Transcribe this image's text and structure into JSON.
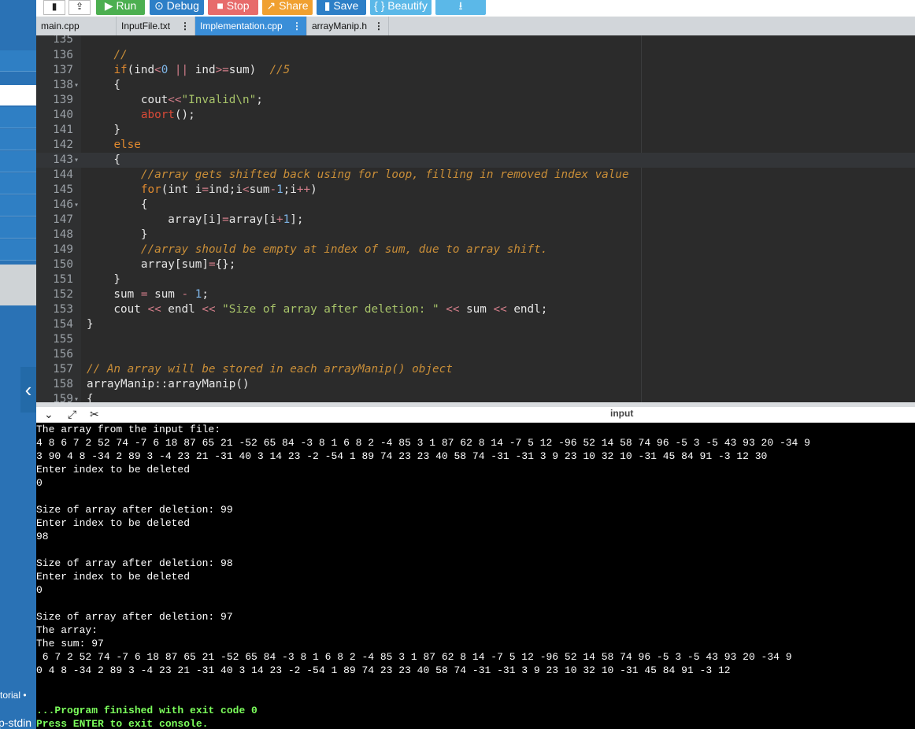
{
  "toolbar": {
    "run": "▶ Run",
    "debug": "⊙ Debug",
    "stop": "■ Stop",
    "share": "↗ Share",
    "save": "▮ Save",
    "beautify": "{ } Beautify",
    "download": "⭳"
  },
  "tabs": [
    {
      "label": "main.cpp"
    },
    {
      "label": "InputFile.txt"
    },
    {
      "label": "Implementation.cpp"
    },
    {
      "label": "arrayManip.h"
    }
  ],
  "tab_menu_glyph": "⋮",
  "sidebar": {
    "collapse_glyph": "‹",
    "tutorial_label": "torial •",
    "stdin_label": "p-stdin"
  },
  "editor": {
    "lines": [
      {
        "n": "135",
        "fold": false
      },
      {
        "n": "136",
        "fold": false
      },
      {
        "n": "137",
        "fold": false
      },
      {
        "n": "138",
        "fold": true
      },
      {
        "n": "139",
        "fold": false
      },
      {
        "n": "140",
        "fold": false
      },
      {
        "n": "141",
        "fold": false
      },
      {
        "n": "142",
        "fold": false
      },
      {
        "n": "143",
        "fold": true
      },
      {
        "n": "144",
        "fold": false
      },
      {
        "n": "145",
        "fold": false
      },
      {
        "n": "146",
        "fold": true
      },
      {
        "n": "147",
        "fold": false
      },
      {
        "n": "148",
        "fold": false
      },
      {
        "n": "149",
        "fold": false
      },
      {
        "n": "150",
        "fold": false
      },
      {
        "n": "151",
        "fold": false
      },
      {
        "n": "152",
        "fold": false
      },
      {
        "n": "153",
        "fold": false
      },
      {
        "n": "154",
        "fold": false
      },
      {
        "n": "155",
        "fold": false
      },
      {
        "n": "156",
        "fold": false
      },
      {
        "n": "157",
        "fold": false
      },
      {
        "n": "158",
        "fold": false
      },
      {
        "n": "159",
        "fold": true
      }
    ],
    "code": {
      "l135": "",
      "l136": "    //",
      "l137a": "    ",
      "l137if": "if",
      "l137b": "(ind",
      "l137op1": "<",
      "l137n0": "0",
      "l137sp": " ",
      "l137or": "||",
      "l137c": " ind",
      "l137op2": ">=",
      "l137d": "sum)  ",
      "l137cm": "//5",
      "l138": "    {",
      "l139a": "        cout",
      "l139op": "<<",
      "l139st": "\"Invalid\\n\"",
      "l139b": ";",
      "l140a": "        ",
      "l140fn": "abort",
      "l140b": "();",
      "l141": "    }",
      "l142a": "    ",
      "l142kw": "else",
      "l143": "    {",
      "l144a": "        ",
      "l144cm": "//array gets shifted back using for loop, filling in removed index value",
      "l145a": "        ",
      "l145kw": "for",
      "l145b": "(int i",
      "l145op1": "=",
      "l145c": "ind;i",
      "l145op2": "<",
      "l145d": "sum",
      "l145op3": "-",
      "l145n1": "1",
      "l145e": ";i",
      "l145op4": "++",
      "l145f": ")",
      "l146": "        {",
      "l147a": "            array[i]",
      "l147op1": "=",
      "l147b": "array[i",
      "l147op2": "+",
      "l147n1": "1",
      "l147c": "];",
      "l148": "        }",
      "l149a": "        ",
      "l149cm": "//array should be empty at index of sum, due to array shift.",
      "l150a": "        array[sum]",
      "l150op": "=",
      "l150b": "{};",
      "l151": "    }",
      "l152a": "    sum ",
      "l152op1": "=",
      "l152b": " sum ",
      "l152op2": "-",
      "l152sp": " ",
      "l152n": "1",
      "l152c": ";",
      "l153a": "    cout ",
      "l153op1": "<<",
      "l153b": " endl ",
      "l153op2": "<<",
      "l153sp": " ",
      "l153st": "\"Size of array after deletion: \"",
      "l153sp2": " ",
      "l153op3": "<<",
      "l153c": " sum ",
      "l153op4": "<<",
      "l153d": " endl;",
      "l154": "}",
      "l155": "",
      "l156": "",
      "l157cm": "// An array will be stored in each arrayManip() object",
      "l158": "arrayManip::arrayManip()",
      "l159": "{"
    }
  },
  "console_toolbar": {
    "label": "input",
    "chevron": "⌄",
    "expand": "⤢",
    "clear": "✂"
  },
  "console": {
    "lines": [
      {
        "text": "The array from the input file:",
        "green": false
      },
      {
        "text": "4 8 6 7 2 52 74 -7 6 18 87 65 21 -52 65 84 -3 8 1 6 8 2 -4 85 3 1 87 62 8 14 -7 5 12 -96 52 14 58 74 96 -5 3 -5 43 93 20 -34 9",
        "green": false
      },
      {
        "text": "3 90 4 8 -34 2 89 3 -4 23 21 -31 40 3 14 23 -2 -54 1 89 74 23 23 40 58 74 -31 -31 3 9 23 10 32 10 -31 45 84 91 -3 12 30",
        "green": false
      },
      {
        "text": "Enter index to be deleted",
        "green": false
      },
      {
        "text": "0",
        "green": false
      },
      {
        "text": "",
        "green": false
      },
      {
        "text": "Size of array after deletion: 99",
        "green": false
      },
      {
        "text": "Enter index to be deleted",
        "green": false
      },
      {
        "text": "98",
        "green": false
      },
      {
        "text": "",
        "green": false
      },
      {
        "text": "Size of array after deletion: 98",
        "green": false
      },
      {
        "text": "Enter index to be deleted",
        "green": false
      },
      {
        "text": "0",
        "green": false
      },
      {
        "text": "",
        "green": false
      },
      {
        "text": "Size of array after deletion: 97",
        "green": false
      },
      {
        "text": "The array:",
        "green": false
      },
      {
        "text": "The sum: 97",
        "green": false
      },
      {
        "text": " 6 7 2 52 74 -7 6 18 87 65 21 -52 65 84 -3 8 1 6 8 2 -4 85 3 1 87 62 8 14 -7 5 12 -96 52 14 58 74 96 -5 3 -5 43 93 20 -34 9",
        "green": false
      },
      {
        "text": "0 4 8 -34 2 89 3 -4 23 21 -31 40 3 14 23 -2 -54 1 89 74 23 23 40 58 74 -31 -31 3 9 23 10 32 10 -31 45 84 91 -3 12",
        "green": false
      },
      {
        "text": "",
        "green": false
      },
      {
        "text": "",
        "green": false
      },
      {
        "text": "...Program finished with exit code 0",
        "green": true
      },
      {
        "text": "Press ENTER to exit console.",
        "green": true
      }
    ]
  },
  "colors": {
    "sidebar": "#2a72b5",
    "run": "#4caf50",
    "debug": "#2d7fc7",
    "stop": "#e76b6b",
    "share": "#f0a030",
    "save": "#2d7fc7",
    "beautify": "#5bb8e8",
    "download": "#5bb8e8",
    "active_tab": "#3a8ed8",
    "editor_bg": "#2b2b2b",
    "console_bg": "#000000",
    "console_green": "#7cff5c"
  }
}
